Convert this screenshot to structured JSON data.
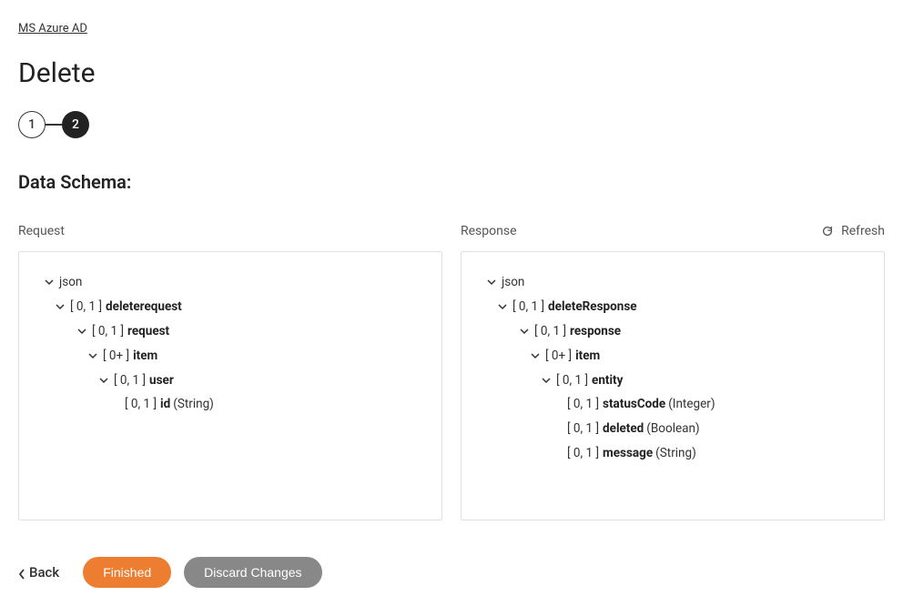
{
  "breadcrumb": "MS Azure AD",
  "page_title": "Delete",
  "stepper": {
    "step1": "1",
    "step2": "2"
  },
  "section_title": "Data Schema:",
  "labels": {
    "request": "Request",
    "response": "Response",
    "refresh": "Refresh"
  },
  "request_tree": {
    "root": "json",
    "n1_card": "[ 0, 1 ]",
    "n1_name": "deleterequest",
    "n2_card": "[ 0, 1 ]",
    "n2_name": "request",
    "n3_card": "[ 0+ ]",
    "n3_name": "item",
    "n4_card": "[ 0, 1 ]",
    "n4_name": "user",
    "n5_card": "[ 0, 1 ]",
    "n5_name": "id",
    "n5_type": "(String)"
  },
  "response_tree": {
    "root": "json",
    "n1_card": "[ 0, 1 ]",
    "n1_name": "deleteResponse",
    "n2_card": "[ 0, 1 ]",
    "n2_name": "response",
    "n3_card": "[ 0+ ]",
    "n3_name": "item",
    "n4_card": "[ 0, 1 ]",
    "n4_name": "entity",
    "n5_card": "[ 0, 1 ]",
    "n5_name": "statusCode",
    "n5_type": "(Integer)",
    "n6_card": "[ 0, 1 ]",
    "n6_name": "deleted",
    "n6_type": "(Boolean)",
    "n7_card": "[ 0, 1 ]",
    "n7_name": "message",
    "n7_type": "(String)"
  },
  "footer": {
    "back": "Back",
    "finished": "Finished",
    "discard": "Discard Changes"
  }
}
